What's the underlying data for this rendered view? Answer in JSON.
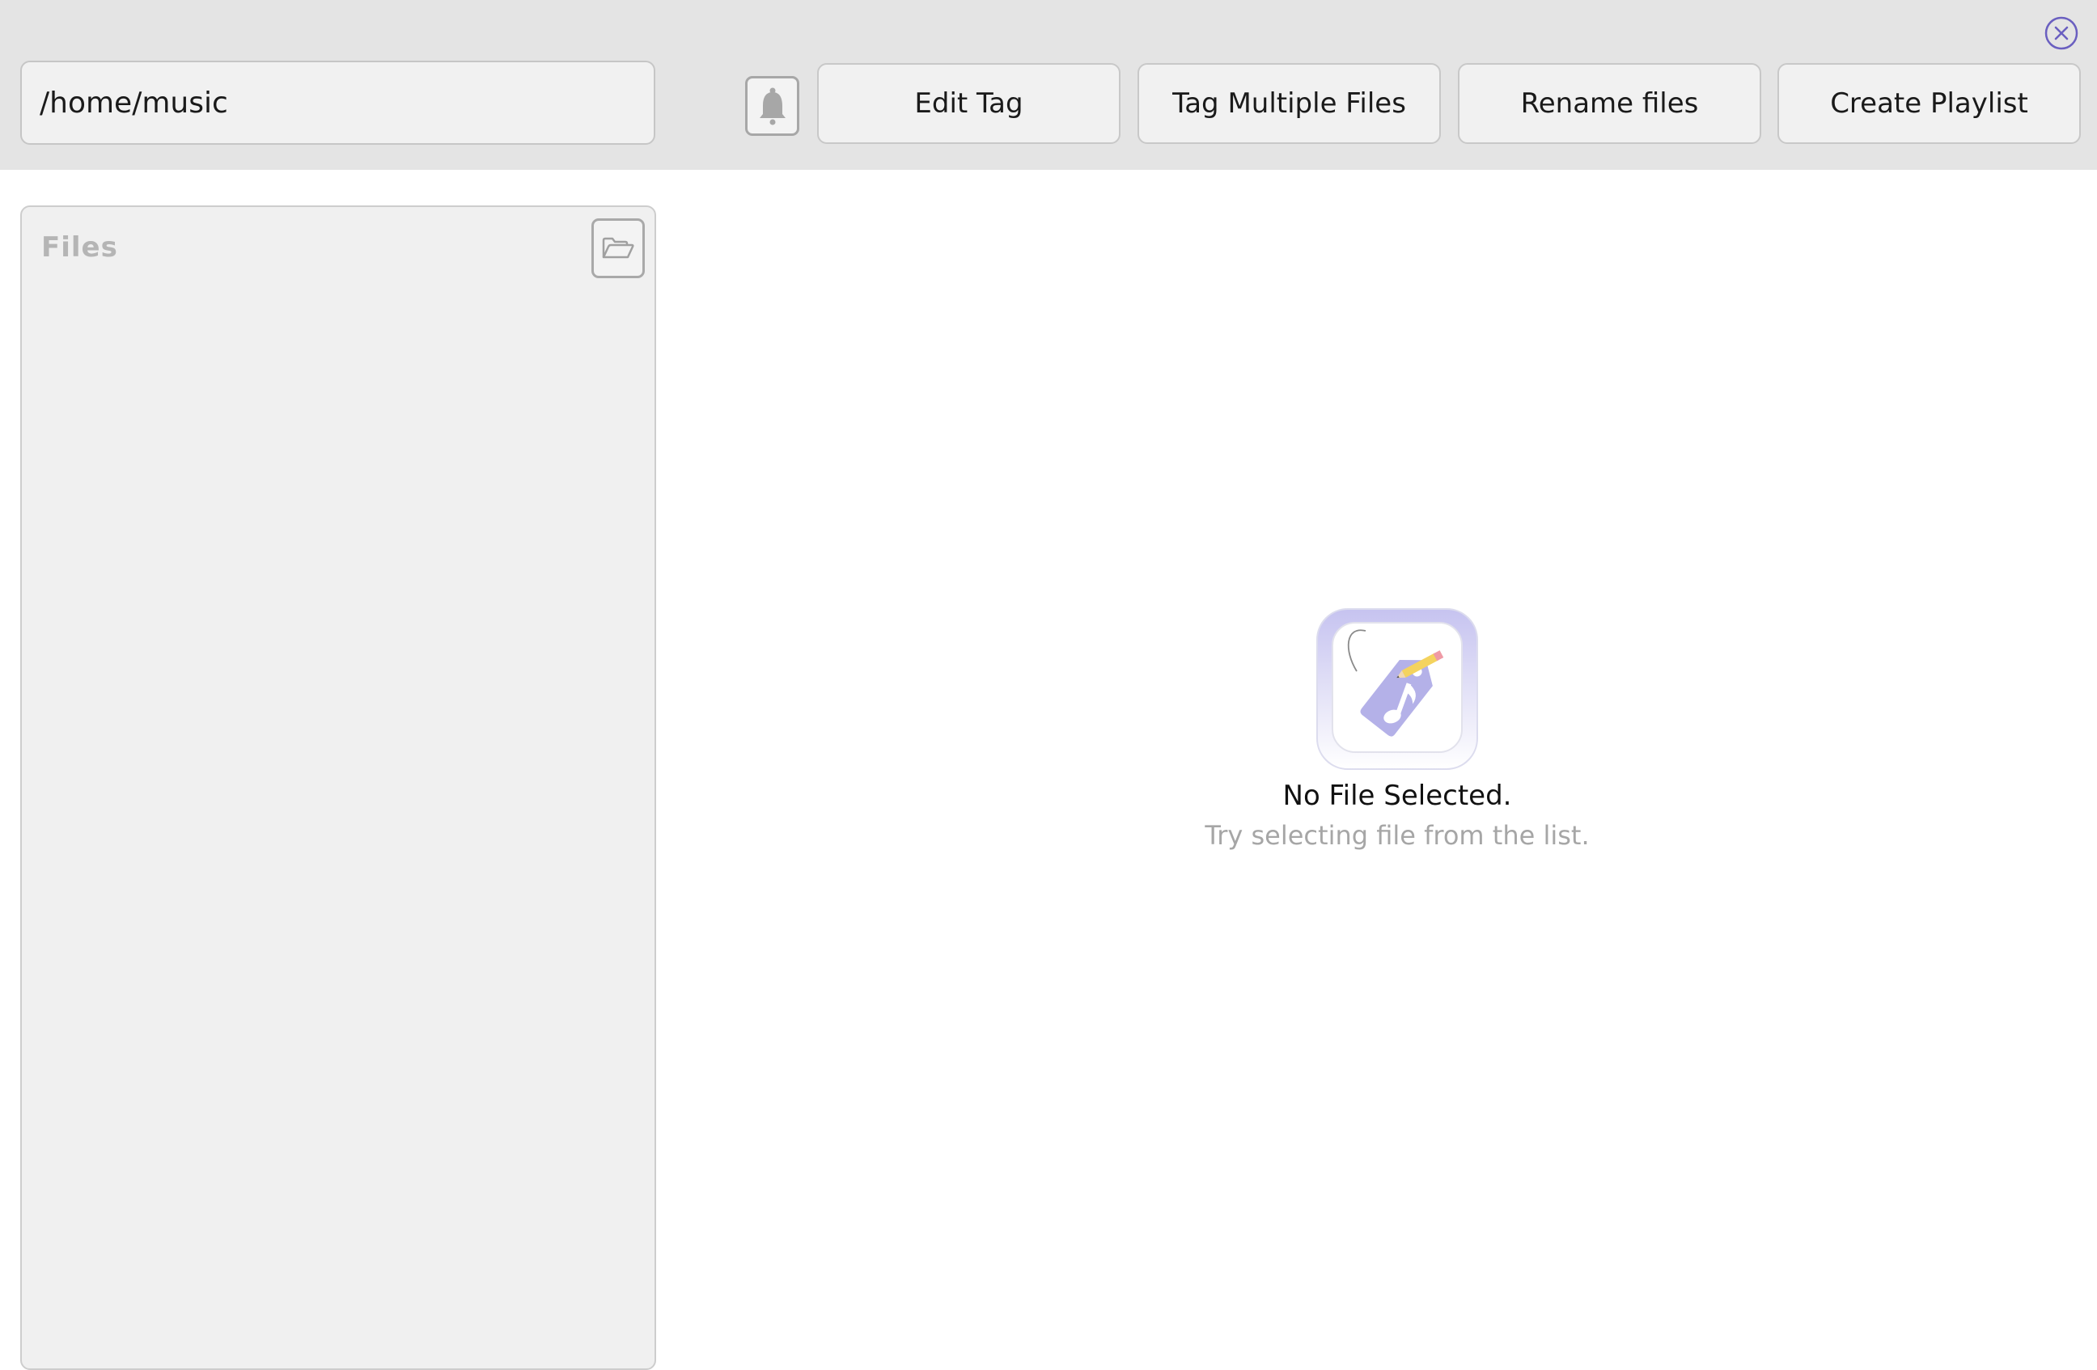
{
  "toolbar": {
    "path_value": "/home/music",
    "buttons": {
      "edit_tag": "Edit Tag",
      "tag_multiple": "Tag Multiple Files",
      "rename": "Rename files",
      "create_playlist": "Create Playlist"
    },
    "icons": {
      "close": "close-circle-icon",
      "notifications": "bell-icon"
    }
  },
  "files_panel": {
    "title": "Files",
    "items": [],
    "open_icon": "folder-open-icon"
  },
  "empty_state": {
    "icon": "music-tag-app-icon",
    "title": "No File Selected.",
    "subtitle": "Try selecting file from the list."
  },
  "colors": {
    "toolbar_bg": "#e4e4e4",
    "accent": "#6a5fc0",
    "icon_tint": "#b4b1e8"
  }
}
